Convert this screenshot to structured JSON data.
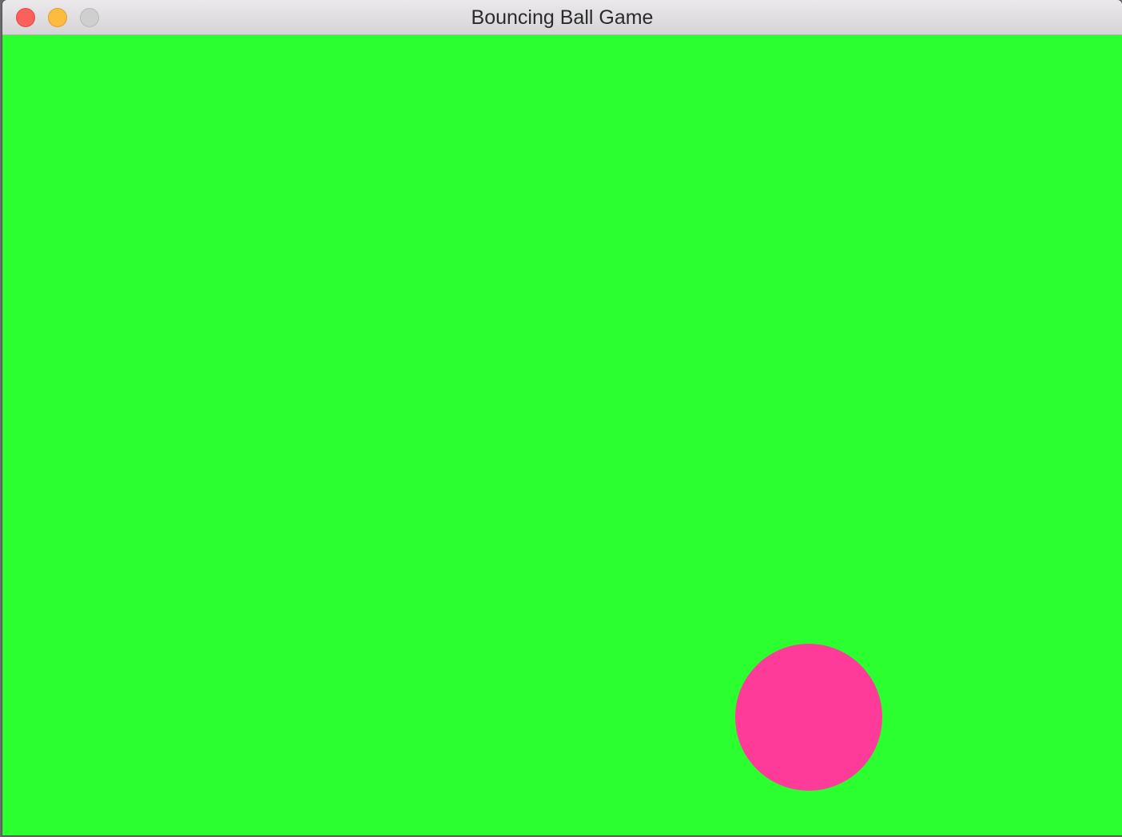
{
  "window": {
    "title": "Bouncing Ball Game"
  },
  "colors": {
    "background": "#2bff30",
    "ball": "#ff3b9a"
  },
  "icons": {
    "close": "close-icon",
    "minimize": "minimize-icon",
    "zoom": "zoom-icon"
  }
}
